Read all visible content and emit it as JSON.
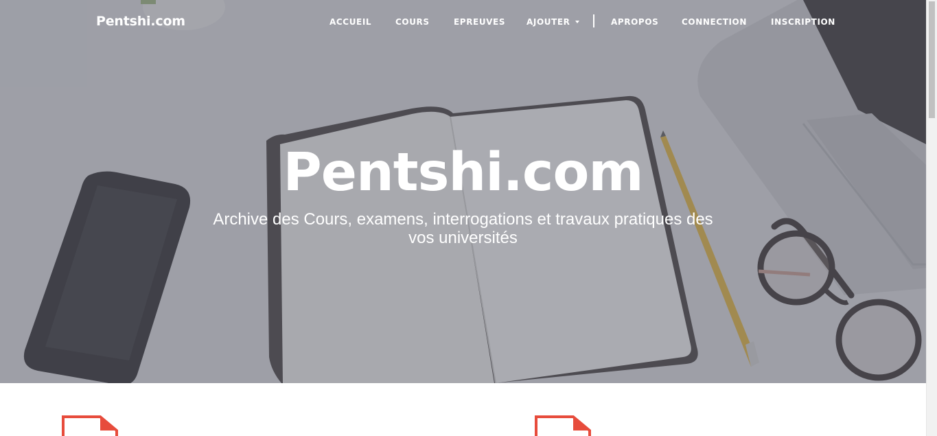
{
  "brand": {
    "name": "Pentshi.com"
  },
  "nav": {
    "items": [
      {
        "label": "ACCUEIL",
        "dropdown": false
      },
      {
        "label": "COURS",
        "dropdown": false
      },
      {
        "label": "EPREUVES",
        "dropdown": false
      },
      {
        "label": "AJOUTER",
        "dropdown": true
      },
      {
        "label": "APROPOS",
        "dropdown": false
      },
      {
        "label": "CONNECTION",
        "dropdown": false
      },
      {
        "label": "INSCRIPTION",
        "dropdown": false
      }
    ]
  },
  "hero": {
    "title": "Pentshi.com",
    "subtitle": "Archive des Cours, examens, interrogations et travaux pratiques des vos universités"
  },
  "content": {
    "document_icons": [
      "pdf-file-icon",
      "pdf-file-icon"
    ]
  },
  "colors": {
    "overlay": "#5f626e",
    "nav_text": "#ffffff",
    "doc_icon": "#e74c3c",
    "background": "#ffffff"
  }
}
